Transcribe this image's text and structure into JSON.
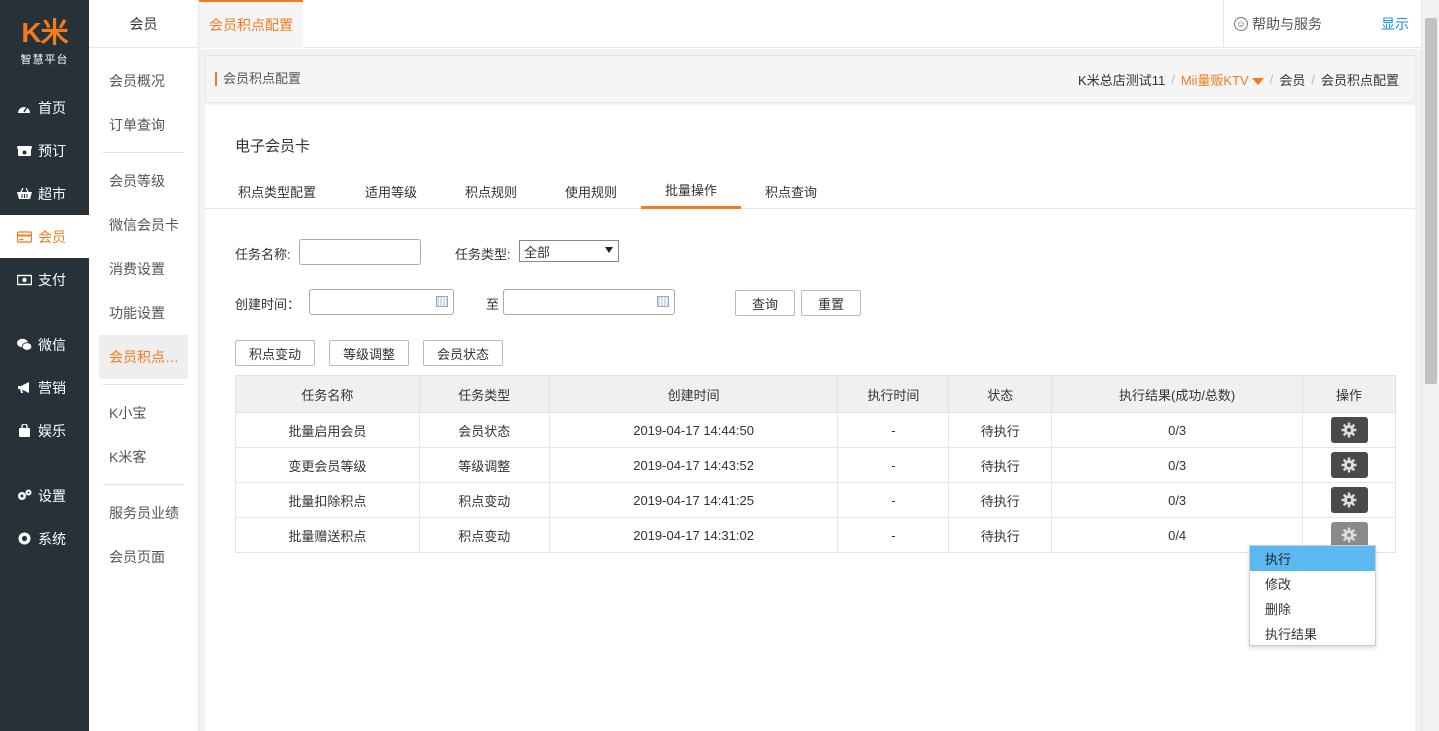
{
  "brand": {
    "logo": "K米",
    "subtitle": "智慧平台"
  },
  "sidebar": {
    "items": [
      {
        "label": "首页",
        "icon": "dashboard-icon"
      },
      {
        "label": "预订",
        "icon": "phone-icon"
      },
      {
        "label": "超市",
        "icon": "basket-icon"
      },
      {
        "label": "会员",
        "icon": "card-icon",
        "active": true
      },
      {
        "label": "支付",
        "icon": "money-icon"
      },
      {
        "label": "微信",
        "icon": "wechat-icon"
      },
      {
        "label": "营销",
        "icon": "bullhorn-icon"
      },
      {
        "label": "娱乐",
        "icon": "bag-icon"
      },
      {
        "label": "设置",
        "icon": "gears-icon"
      },
      {
        "label": "系统",
        "icon": "chrome-icon"
      }
    ]
  },
  "subnav": {
    "header": "会员",
    "items": [
      "会员概况",
      "订单查询",
      "会员等级",
      "微信会员卡",
      "消费设置",
      "功能设置",
      "会员积点…",
      "K小宝",
      "K米客",
      "服务员业绩",
      "会员页面"
    ]
  },
  "topbar": {
    "tab": "会员积点配置",
    "help": "帮助与服务",
    "show": "显示"
  },
  "breadcrumb": {
    "title": "会员积点配置",
    "items": [
      "K米总店测试11",
      "Mii量贩KTV",
      "会员",
      "会员积点配置"
    ]
  },
  "card": {
    "title": "电子会员卡",
    "tabs": [
      "积点类型配置",
      "适用等级",
      "积点规则",
      "使用规则",
      "批量操作",
      "积点查询"
    ]
  },
  "filters": {
    "task_name_label": "任务名称:",
    "task_name_value": "",
    "task_type_label": "任务类型:",
    "task_type_value": "全部",
    "created_label": "创建时间：",
    "to_label": "至",
    "query": "查询",
    "reset": "重置"
  },
  "actions": [
    "积点变动",
    "等级调整",
    "会员状态"
  ],
  "table": {
    "headers": [
      "任务名称",
      "任务类型",
      "创建时间",
      "执行时间",
      "状态",
      "执行结果(成功/总数)",
      "操作"
    ],
    "rows": [
      [
        "批量启用会员",
        "会员状态",
        "2019-04-17 14:44:50",
        "-",
        "待执行",
        "0/3"
      ],
      [
        "变更会员等级",
        "等级调整",
        "2019-04-17 14:43:52",
        "-",
        "待执行",
        "0/3"
      ],
      [
        "批量扣除积点",
        "积点变动",
        "2019-04-17 14:41:25",
        "-",
        "待执行",
        "0/3"
      ],
      [
        "批量赠送积点",
        "积点变动",
        "2019-04-17 14:31:02",
        "-",
        "待执行",
        "0/4"
      ]
    ]
  },
  "dropdown": [
    "执行",
    "修改",
    "删除",
    "执行结果"
  ],
  "colors": {
    "accent": "#f37b1d",
    "sidebar": "#263238",
    "link": "#1b8be8",
    "highlight": "#5bb8f0"
  }
}
